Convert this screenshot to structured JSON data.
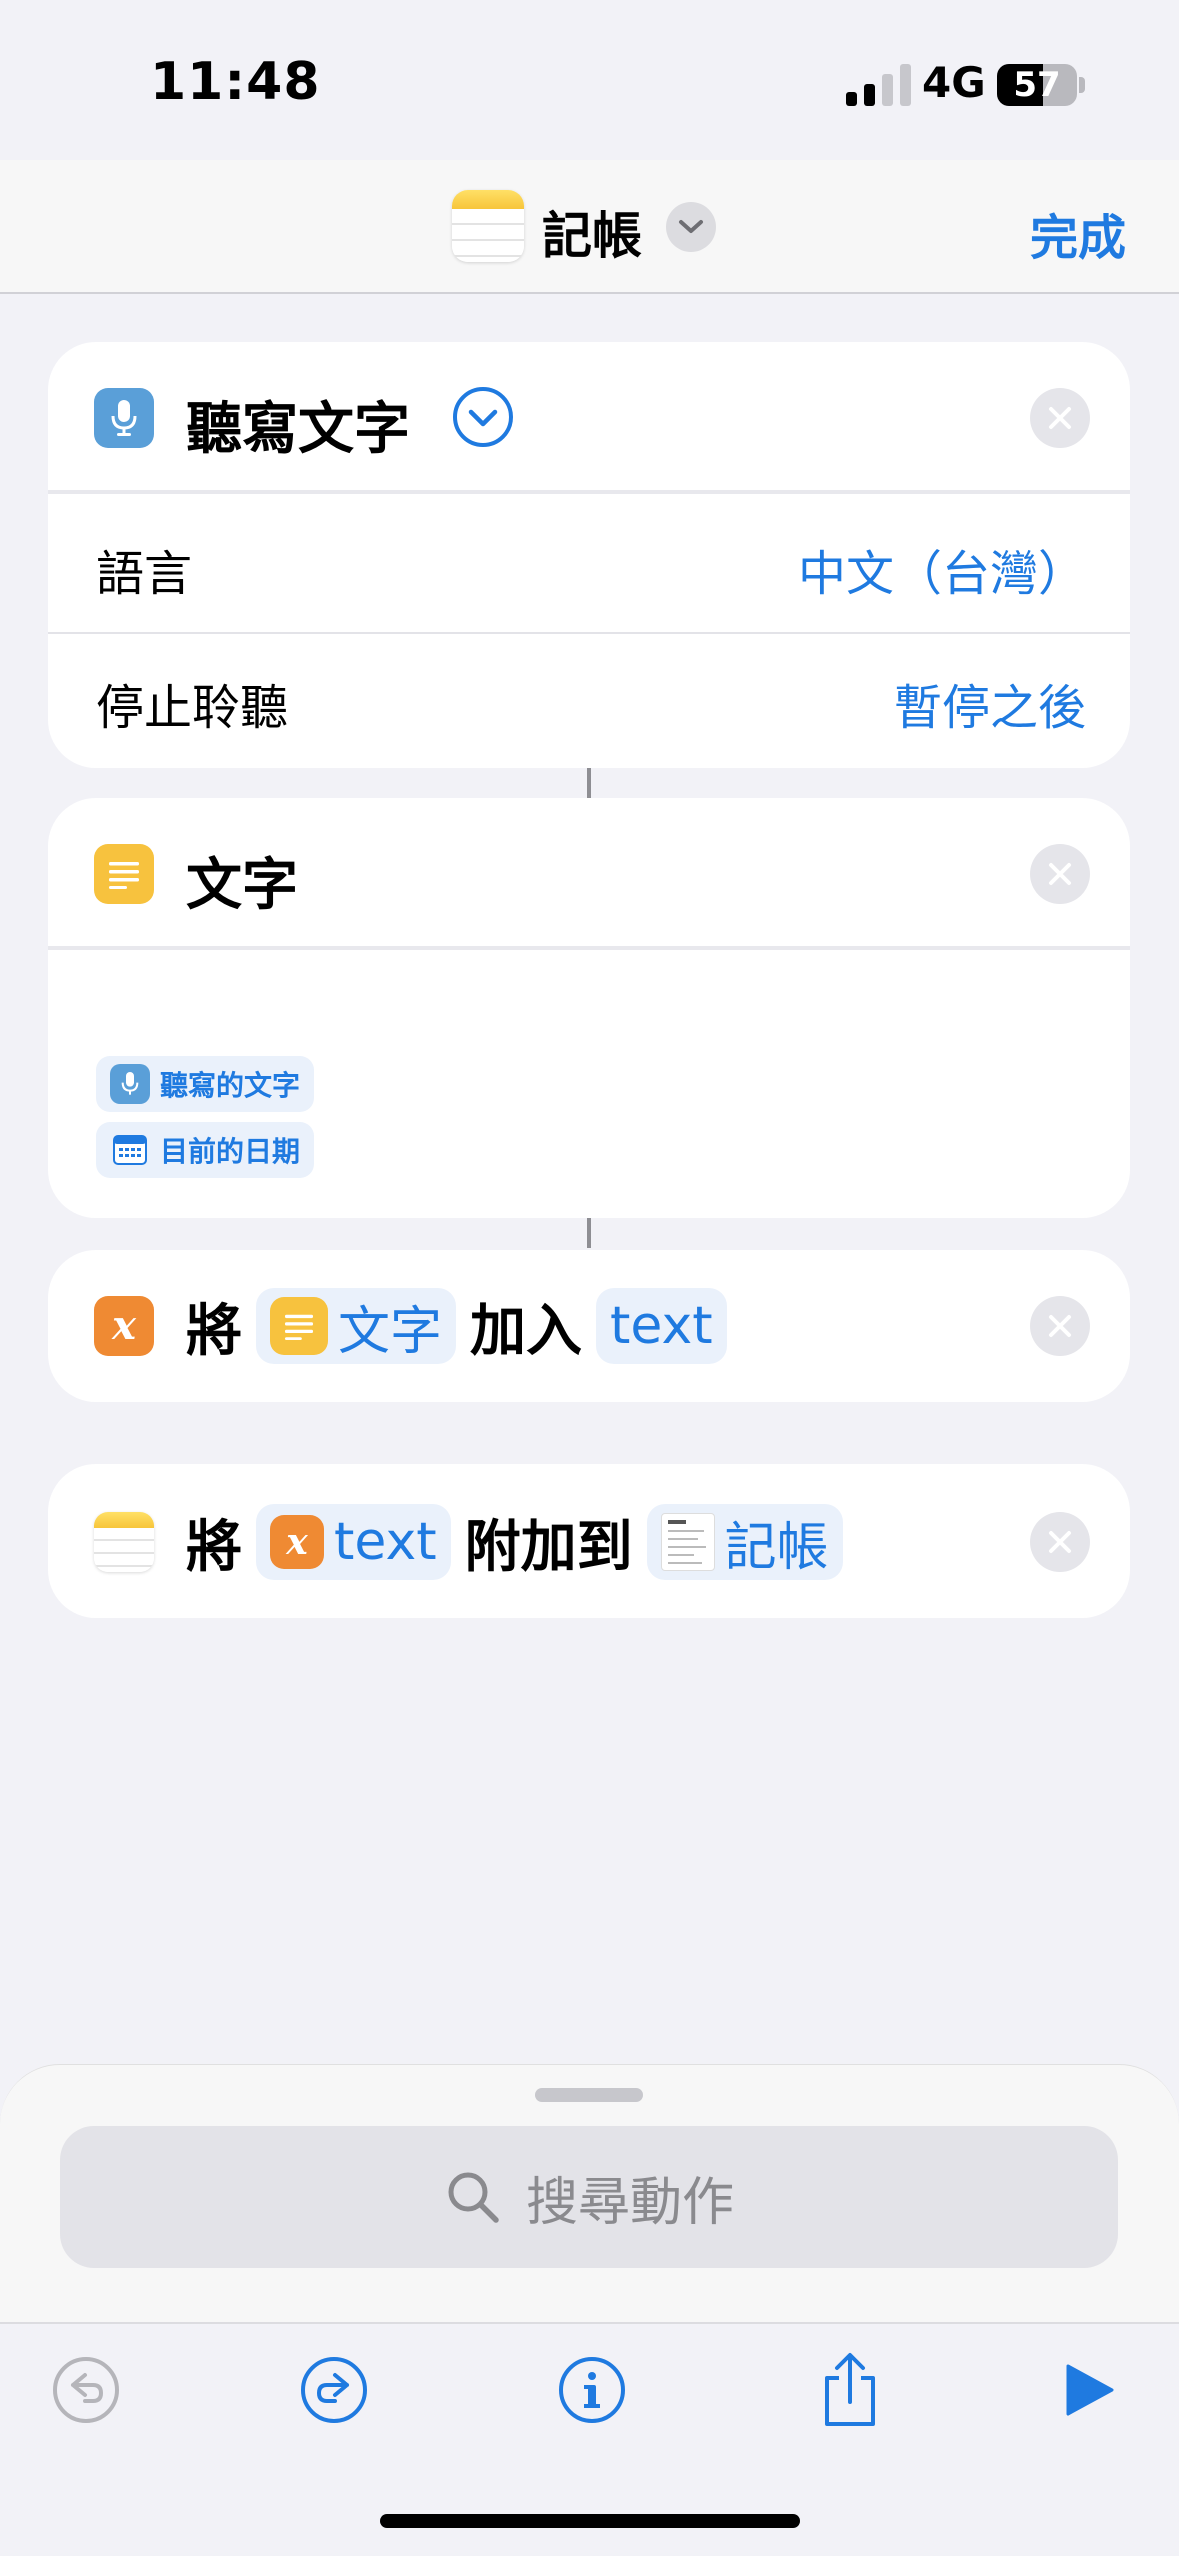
{
  "status": {
    "time": "11:48",
    "network": "4G",
    "battery": "57"
  },
  "nav": {
    "title": "記帳",
    "done": "完成",
    "icon": "notes-app-icon"
  },
  "actions": {
    "dictate": {
      "title": "聽寫文字",
      "language_label": "語言",
      "language_value": "中文（台灣）",
      "stop_label": "停止聆聽",
      "stop_value": "暫停之後",
      "icon": "microphone-icon"
    },
    "text": {
      "title": "文字",
      "tokens": [
        "聽寫的文字",
        "目前的日期"
      ],
      "icon": "text-lines-icon"
    },
    "add_variable": {
      "verb": "將",
      "token_text": "文字",
      "middle": "加入",
      "variable": "text"
    },
    "append_note": {
      "verb": "將",
      "variable": "text",
      "middle": "附加到",
      "note": "記帳"
    }
  },
  "search": {
    "placeholder": "搜尋動作"
  },
  "colors": {
    "accent": "#1f7ae0",
    "blue_icon": "#5a9fd8",
    "yellow_icon": "#f7c23e",
    "orange_icon": "#ef8a33"
  }
}
